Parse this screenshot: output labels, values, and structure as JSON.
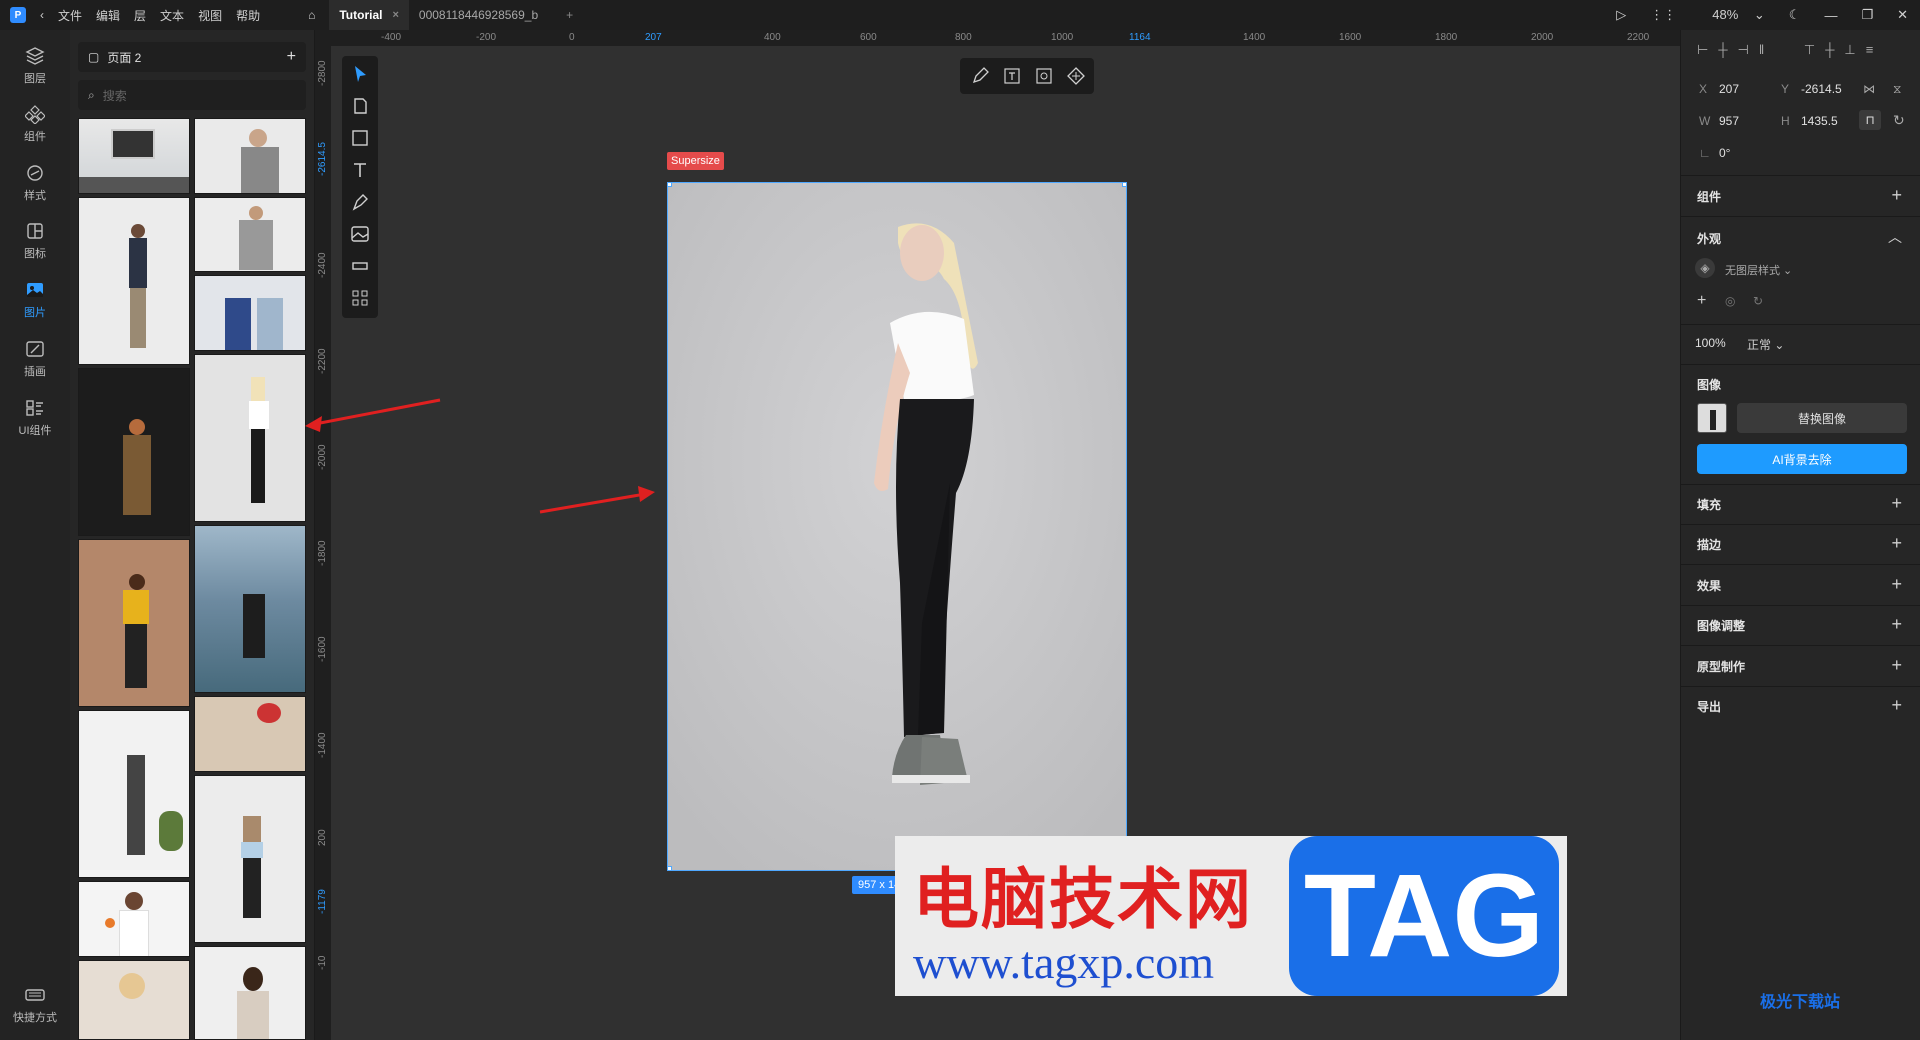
{
  "titlebar": {
    "menus": [
      "文件",
      "编辑",
      "层",
      "文本",
      "视图",
      "帮助"
    ],
    "tabs": [
      {
        "label": "Tutorial",
        "active": true
      },
      {
        "label": "0008118446928569_b",
        "active": false
      }
    ],
    "zoom": "48%"
  },
  "rail": [
    {
      "label": "图层",
      "icon": "layers-icon"
    },
    {
      "label": "组件",
      "icon": "component-icon"
    },
    {
      "label": "样式",
      "icon": "style-icon"
    },
    {
      "label": "图标",
      "icon": "icons-icon"
    },
    {
      "label": "图片",
      "icon": "image-icon",
      "active": true
    },
    {
      "label": "插画",
      "icon": "illustration-icon"
    },
    {
      "label": "UI组件",
      "icon": "ui-kit-icon"
    },
    {
      "label": "快捷方式",
      "icon": "keyboard-icon"
    }
  ],
  "assets": {
    "page": "页面 2",
    "search_placeholder": "搜索"
  },
  "rulers": {
    "top": [
      "-400",
      "-200",
      "0",
      "207",
      "400",
      "600",
      "800",
      "1000",
      "1164",
      "1400",
      "1600",
      "1800",
      "2000",
      "2200"
    ],
    "left": [
      "-2800",
      "-2614.5",
      "-2400",
      "-2200",
      "-2000",
      "-1800",
      "-1600",
      "-1400",
      "200",
      "-1179",
      "-10"
    ]
  },
  "canvas": {
    "frame_tag": "Supersize",
    "size_badge": "957 x 143"
  },
  "watermark": {
    "cn": "电脑技术网",
    "url": "www.tagxp.com",
    "tag": "TAG",
    "site": "极光下载站"
  },
  "props": {
    "x_label": "X",
    "x": "207",
    "y_label": "Y",
    "y": "-2614.5",
    "w_label": "W",
    "w": "957",
    "h_label": "H",
    "h": "1435.5",
    "rotation": "0°",
    "components": "组件",
    "appearance": "外观",
    "layer_style": "无图层样式",
    "opacity": "100%",
    "blend": "正常",
    "image": "图像",
    "replace_image": "替换图像",
    "ai_remove_bg": "AI背景去除",
    "fill": "填充",
    "stroke": "描边",
    "effects": "效果",
    "image_adjust": "图像调整",
    "prototype": "原型制作",
    "export": "导出"
  },
  "colors": {
    "accent": "#2f9cff",
    "tag_red": "#e54b4b"
  }
}
